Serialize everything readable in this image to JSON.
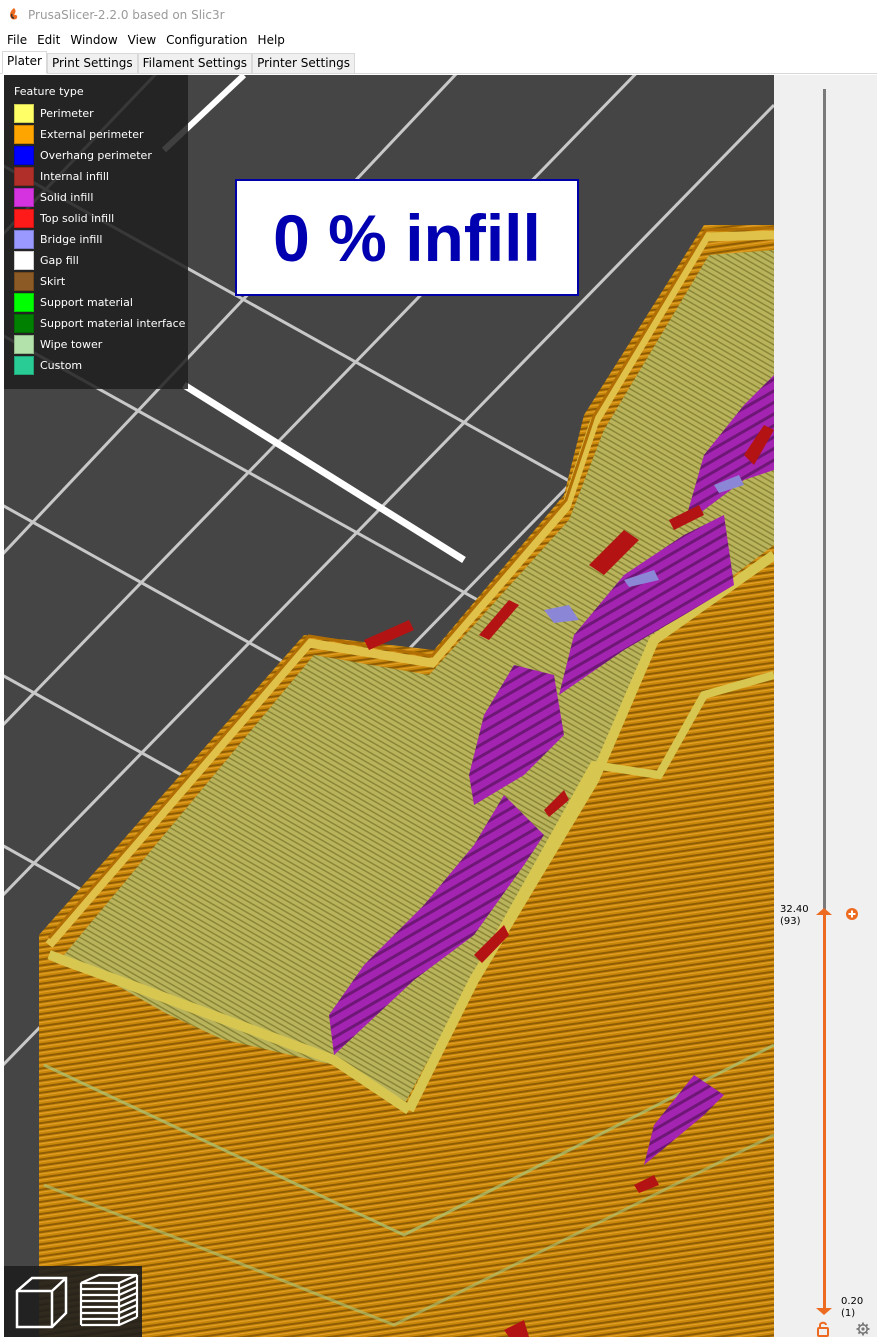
{
  "window": {
    "title": "PrusaSlicer-2.2.0 based on Slic3r",
    "app_icon": "prusaslicer-logo-icon"
  },
  "menu": {
    "items": [
      "File",
      "Edit",
      "Window",
      "View",
      "Configuration",
      "Help"
    ]
  },
  "tabs": [
    {
      "label": "Plater",
      "active": true
    },
    {
      "label": "Print Settings",
      "active": false
    },
    {
      "label": "Filament Settings",
      "active": false
    },
    {
      "label": "Printer Settings",
      "active": false
    }
  ],
  "legend": {
    "title": "Feature type",
    "items": [
      {
        "label": "Perimeter",
        "color": "#ffff66"
      },
      {
        "label": "External perimeter",
        "color": "#ffa500"
      },
      {
        "label": "Overhang perimeter",
        "color": "#0000ff"
      },
      {
        "label": "Internal infill",
        "color": "#b03029"
      },
      {
        "label": "Solid infill",
        "color": "#d633e0"
      },
      {
        "label": "Top solid infill",
        "color": "#ff1a1a"
      },
      {
        "label": "Bridge infill",
        "color": "#9999ff"
      },
      {
        "label": "Gap fill",
        "color": "#ffffff"
      },
      {
        "label": "Skirt",
        "color": "#8c5a24"
      },
      {
        "label": "Support material",
        "color": "#00ff00"
      },
      {
        "label": "Support material interface",
        "color": "#008000"
      },
      {
        "label": "Wipe tower",
        "color": "#b3e3ab"
      },
      {
        "label": "Custom",
        "color": "#28cc94"
      }
    ]
  },
  "overlay": {
    "text": "0 % infill"
  },
  "layer_slider": {
    "upper_height": "32.40",
    "upper_layer": "(93)",
    "lower_height": "0.20",
    "lower_layer": "(1)",
    "accent_color": "#ed6b21"
  },
  "view_buttons": [
    "3d-view-cube-icon",
    "layers-preview-icon"
  ]
}
